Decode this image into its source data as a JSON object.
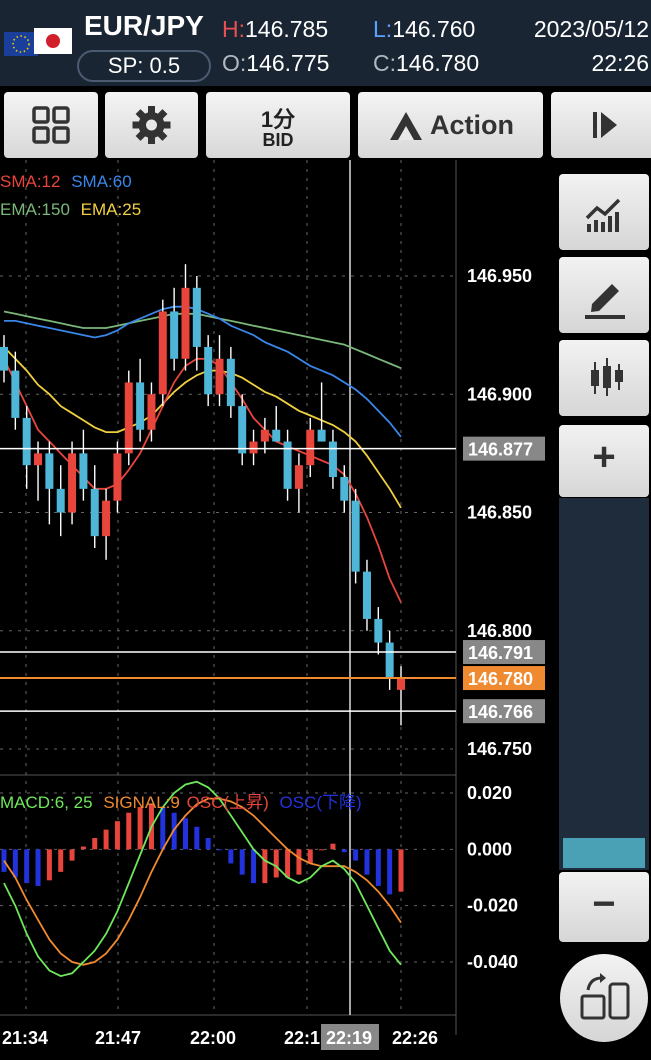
{
  "header": {
    "pair": "EUR/JPY",
    "spread": "SP: 0.5",
    "high_label": "H:",
    "high": "146.785",
    "open_label": "O:",
    "open": "146.775",
    "low_label": "L:",
    "low": "146.760",
    "close_label": "C:",
    "close": "146.780",
    "date": "2023/05/12",
    "time": "22:26"
  },
  "toolbar": {
    "timeframe": "1分",
    "price_type": "BID",
    "action_label": "Action"
  },
  "legend": {
    "sma12": "SMA:12",
    "sma60": "SMA:60",
    "ema150": "EMA:150",
    "ema25": "EMA:25",
    "macd": "MACD:6, 25",
    "signal": "SIGNAL:9",
    "osc_up": "OSC(上昇)",
    "osc_down": "OSC(下降)"
  },
  "price_axis": [
    "146.950",
    "146.900",
    "146.850",
    "146.800",
    "146.750"
  ],
  "price_tags": {
    "line1": "146.877",
    "line2": "146.791",
    "current": "146.780",
    "line3": "146.766"
  },
  "macd_axis": [
    "0.020",
    "0.000",
    "-0.020",
    "-0.040"
  ],
  "time_axis": [
    "21:34",
    "21:47",
    "22:00",
    "22:1",
    "22:19",
    "22:26"
  ],
  "colors": {
    "up": "#e8453c",
    "down": "#4fb6d8",
    "sma12": "#e8453c",
    "sma60": "#3a86e8",
    "ema150": "#7ab87a",
    "ema25": "#f0d040",
    "current": "#f08a30",
    "macd": "#6ee85a",
    "signal": "#f08a30",
    "osc_up": "#e8453c",
    "osc_down": "#2233dd"
  },
  "chart_data": {
    "type": "candlestick",
    "y_range": [
      146.735,
      146.97
    ],
    "candles": [
      [
        146.92,
        146.925,
        146.905,
        146.91
      ],
      [
        146.91,
        146.918,
        146.885,
        146.89
      ],
      [
        146.89,
        146.895,
        146.86,
        146.87
      ],
      [
        146.87,
        146.88,
        146.855,
        146.875
      ],
      [
        146.875,
        146.88,
        146.845,
        146.86
      ],
      [
        146.86,
        146.87,
        146.84,
        146.85
      ],
      [
        146.85,
        146.88,
        146.845,
        146.875
      ],
      [
        146.875,
        146.885,
        146.855,
        146.86
      ],
      [
        146.86,
        146.87,
        146.835,
        146.84
      ],
      [
        146.84,
        146.86,
        146.83,
        146.855
      ],
      [
        146.855,
        146.88,
        146.85,
        146.875
      ],
      [
        146.875,
        146.91,
        146.87,
        146.905
      ],
      [
        146.905,
        146.915,
        146.88,
        146.885
      ],
      [
        146.885,
        146.905,
        146.88,
        146.9
      ],
      [
        146.9,
        146.94,
        146.895,
        146.935
      ],
      [
        146.935,
        146.945,
        146.91,
        146.915
      ],
      [
        146.915,
        146.955,
        146.91,
        146.945
      ],
      [
        146.945,
        146.95,
        146.91,
        146.92
      ],
      [
        146.92,
        146.925,
        146.895,
        146.9
      ],
      [
        146.9,
        146.925,
        146.895,
        146.915
      ],
      [
        146.915,
        146.92,
        146.89,
        146.895
      ],
      [
        146.895,
        146.9,
        146.87,
        146.875
      ],
      [
        146.875,
        146.885,
        146.87,
        146.88
      ],
      [
        146.88,
        146.89,
        146.875,
        146.885
      ],
      [
        146.885,
        146.895,
        146.88,
        146.88
      ],
      [
        146.88,
        146.885,
        146.855,
        146.86
      ],
      [
        146.86,
        146.875,
        146.85,
        146.87
      ],
      [
        146.87,
        146.89,
        146.865,
        146.885
      ],
      [
        146.885,
        146.905,
        146.88,
        146.88
      ],
      [
        146.88,
        146.885,
        146.86,
        146.865
      ],
      [
        146.865,
        146.87,
        146.85,
        146.855
      ],
      [
        146.855,
        146.86,
        146.82,
        146.825
      ],
      [
        146.825,
        146.83,
        146.8,
        146.805
      ],
      [
        146.805,
        146.81,
        146.79,
        146.795
      ],
      [
        146.795,
        146.8,
        146.775,
        146.78
      ],
      [
        146.775,
        146.785,
        146.76,
        146.78
      ]
    ],
    "sma12": [
      146.915,
      146.905,
      146.895,
      146.885,
      146.88,
      146.875,
      146.87,
      146.865,
      146.86,
      146.86,
      146.862,
      146.868,
      146.875,
      146.885,
      146.895,
      146.905,
      146.912,
      146.915,
      146.915,
      146.912,
      146.905,
      146.898,
      146.89,
      146.885,
      146.88,
      146.878,
      146.876,
      146.874,
      146.872,
      146.87,
      146.866,
      146.858,
      146.848,
      146.836,
      146.822,
      146.812
    ],
    "ema25": [
      146.92,
      146.915,
      146.91,
      146.904,
      146.9,
      146.895,
      146.892,
      146.889,
      146.886,
      146.884,
      146.884,
      146.886,
      146.888,
      146.891,
      146.896,
      146.901,
      146.905,
      146.908,
      146.91,
      146.91,
      146.909,
      146.907,
      146.904,
      146.901,
      146.899,
      146.896,
      146.893,
      146.891,
      146.889,
      146.887,
      146.884,
      146.88,
      146.874,
      146.867,
      146.86,
      146.852
    ],
    "sma60": [
      146.931,
      146.931,
      146.93,
      146.929,
      146.928,
      146.927,
      146.926,
      146.925,
      146.924,
      146.925,
      146.927,
      146.93,
      146.932,
      146.934,
      146.936,
      146.937,
      146.937,
      146.936,
      146.934,
      146.932,
      146.929,
      146.927,
      146.925,
      146.922,
      146.92,
      146.918,
      146.915,
      146.912,
      146.91,
      146.908,
      146.905,
      146.902,
      146.898,
      146.893,
      146.888,
      146.882
    ],
    "ema150": [
      146.935,
      146.934,
      146.933,
      146.932,
      146.931,
      146.93,
      146.929,
      146.928,
      146.928,
      146.928,
      146.929,
      146.93,
      146.931,
      146.932,
      146.933,
      146.934,
      146.934,
      146.934,
      146.933,
      146.932,
      146.931,
      146.93,
      146.929,
      146.928,
      146.927,
      146.926,
      146.925,
      146.924,
      146.923,
      146.922,
      146.921,
      146.919,
      146.917,
      146.915,
      146.913,
      146.911
    ],
    "macd_range": [
      -0.05,
      0.03
    ],
    "macd": [
      -0.012,
      -0.02,
      -0.03,
      -0.038,
      -0.043,
      -0.045,
      -0.044,
      -0.04,
      -0.036,
      -0.03,
      -0.022,
      -0.012,
      -0.002,
      0.008,
      0.015,
      0.02,
      0.023,
      0.024,
      0.022,
      0.018,
      0.012,
      0.006,
      0.0,
      -0.004,
      -0.006,
      -0.01,
      -0.012,
      -0.01,
      -0.006,
      -0.004,
      -0.007,
      -0.012,
      -0.02,
      -0.028,
      -0.036,
      -0.041
    ],
    "signal": [
      -0.004,
      -0.01,
      -0.018,
      -0.025,
      -0.032,
      -0.037,
      -0.04,
      -0.041,
      -0.04,
      -0.037,
      -0.032,
      -0.025,
      -0.017,
      -0.008,
      0.0,
      0.007,
      0.012,
      0.016,
      0.018,
      0.018,
      0.017,
      0.015,
      0.012,
      0.008,
      0.004,
      0.0,
      -0.003,
      -0.005,
      -0.006,
      -0.006,
      -0.006,
      -0.008,
      -0.011,
      -0.015,
      -0.02,
      -0.026
    ],
    "osc": [
      -0.008,
      -0.01,
      -0.012,
      -0.013,
      -0.011,
      -0.008,
      -0.004,
      0.001,
      0.004,
      0.007,
      0.01,
      0.013,
      0.015,
      0.016,
      0.015,
      0.013,
      0.011,
      0.008,
      0.004,
      0.0,
      -0.005,
      -0.009,
      -0.012,
      -0.012,
      -0.01,
      -0.01,
      -0.009,
      -0.005,
      0.0,
      0.002,
      -0.001,
      -0.004,
      -0.009,
      -0.013,
      -0.016,
      -0.015
    ]
  },
  "sidebar": {
    "plus": "+",
    "minus": "−"
  }
}
